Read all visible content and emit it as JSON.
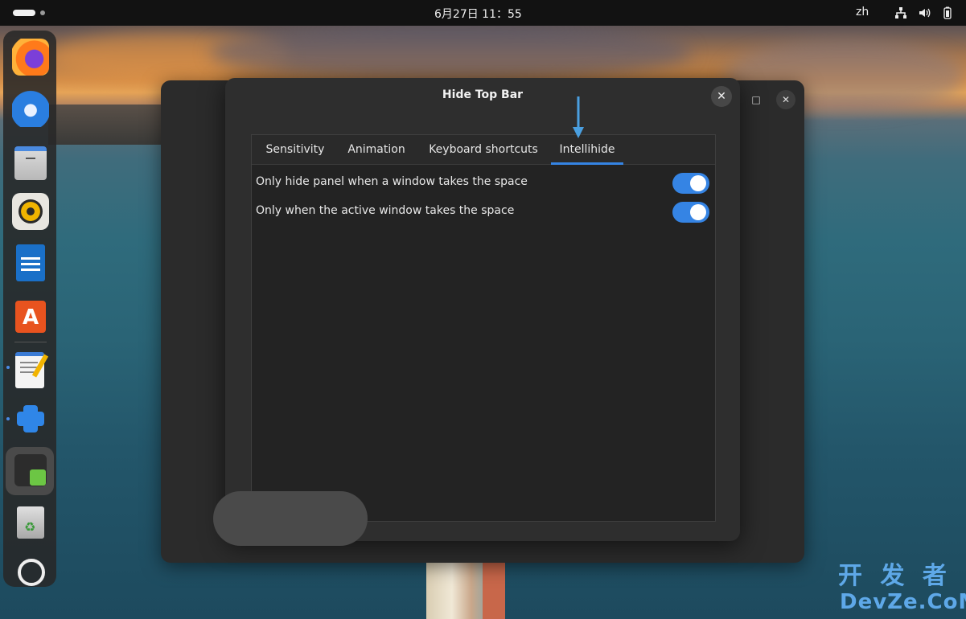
{
  "topbar": {
    "clock": "6月27日  11：55",
    "lang": "zh",
    "icons": [
      "activities-icon",
      "network-icon",
      "volume-icon",
      "battery-icon"
    ]
  },
  "dock": {
    "apps": [
      "firefox-icon",
      "thunderbird-icon",
      "files-icon",
      "rhythmbox-icon",
      "libreoffice-writer-icon",
      "app-center-icon",
      "text-editor-icon",
      "extensions-icon",
      "extension-manager-icon",
      "trash-icon",
      "show-apps-icon"
    ]
  },
  "dialog": {
    "title": "Hide Top Bar",
    "close": "✕",
    "tabs": [
      {
        "label": "Sensitivity"
      },
      {
        "label": "Animation"
      },
      {
        "label": "Keyboard shortcuts"
      },
      {
        "label": "Intellihide",
        "active": true
      }
    ],
    "rows": [
      {
        "label": "Only hide panel when a window takes the space",
        "enabled": true
      },
      {
        "label": "Only when the active window takes the space",
        "enabled": true
      }
    ]
  },
  "background_window": {
    "maximize": "□",
    "close": "✕"
  },
  "annotation": {
    "color": "#4a9fe0"
  },
  "watermark": {
    "line1": "开 发 者",
    "line2": "DevZe.CoM"
  },
  "colors": {
    "accent": "#3584e4",
    "topbar": "#121212",
    "dialog": "#2e2e2e"
  }
}
